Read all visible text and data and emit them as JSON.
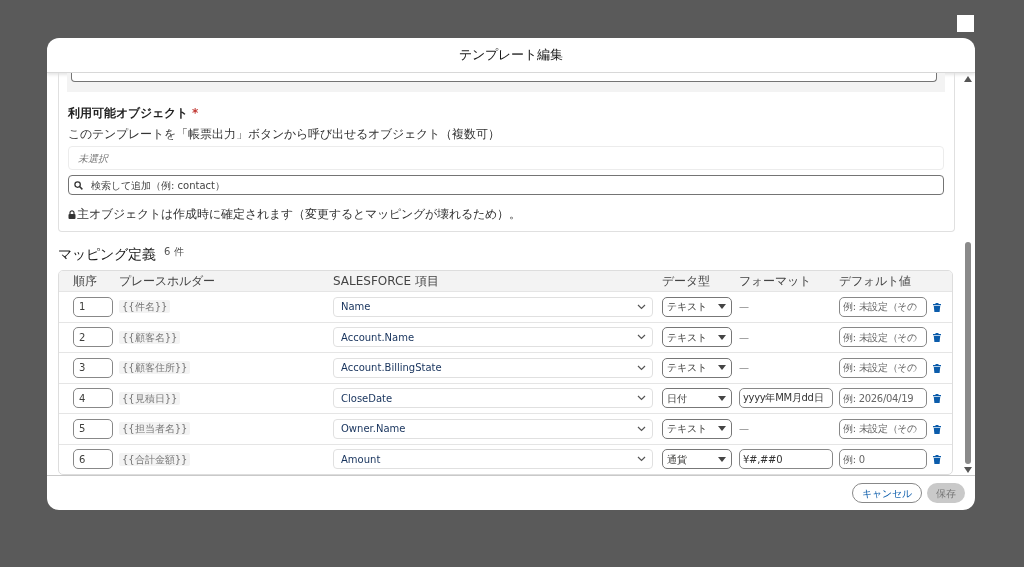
{
  "dialog": {
    "title": "テンプレート編集"
  },
  "objects_section": {
    "label": "利用可能オブジェクト",
    "required_mark": "*",
    "description": "このテンプレートを「帳票出力」ボタンから呼び出せるオブジェクト（複数可）",
    "selection_placeholder": "未選択",
    "search": {
      "placeholder": "検索して追加（例: contact）"
    },
    "note": "主オブジェクトは作成時に確定されます（変更するとマッピングが壊れるため）。"
  },
  "mapping": {
    "title": "マッピング定義",
    "count": "6 件",
    "columns": [
      "順序",
      "プレースホルダー",
      "SALESFORCE 項目",
      "データ型",
      "フォーマット",
      "デフォルト値"
    ],
    "rows": [
      {
        "order": "1",
        "placeholder": "{{件名}}",
        "field": "Name",
        "data_type": "テキスト",
        "format": {
          "kind": "none",
          "text": "—"
        },
        "default_placeholder": "例: 未設定（その"
      },
      {
        "order": "2",
        "placeholder": "{{顧客名}}",
        "field": "Account.Name",
        "data_type": "テキスト",
        "format": {
          "kind": "none",
          "text": "—"
        },
        "default_placeholder": "例: 未設定（その"
      },
      {
        "order": "3",
        "placeholder": "{{顧客住所}}",
        "field": "Account.BillingState",
        "data_type": "テキスト",
        "format": {
          "kind": "none",
          "text": "—"
        },
        "default_placeholder": "例: 未設定（その"
      },
      {
        "order": "4",
        "placeholder": "{{見積日}}",
        "field": "CloseDate",
        "data_type": "日付",
        "format": {
          "kind": "input",
          "text": "yyyy年MM月dd日"
        },
        "default_placeholder": "例: 2026/04/19"
      },
      {
        "order": "5",
        "placeholder": "{{担当者名}}",
        "field": "Owner.Name",
        "data_type": "テキスト",
        "format": {
          "kind": "none",
          "text": "—"
        },
        "default_placeholder": "例: 未設定（その"
      },
      {
        "order": "6",
        "placeholder": "{{合計金額}}",
        "field": "Amount",
        "data_type": "通貨",
        "format": {
          "kind": "input",
          "text": "¥#,##0"
        },
        "default_placeholder": "例: 0"
      }
    ]
  },
  "footer": {
    "buttons": [
      {
        "label": "キャンセル",
        "kind": "secondary",
        "disabled": false
      },
      {
        "label": "保存",
        "kind": "primary",
        "disabled": true
      }
    ]
  }
}
